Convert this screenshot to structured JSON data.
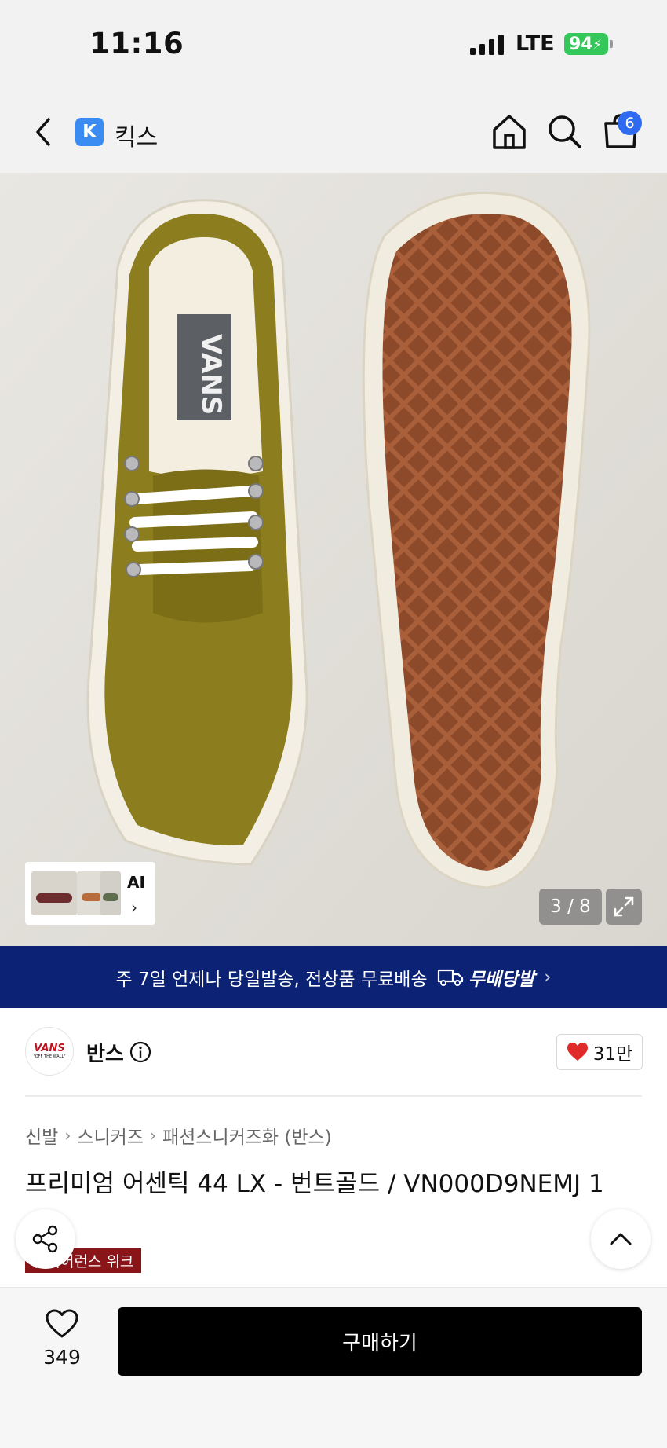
{
  "status": {
    "time": "11:16",
    "network": "LTE",
    "battery": "94"
  },
  "nav": {
    "logo_letter": "K",
    "title": "킥스",
    "cart_count": "6"
  },
  "gallery": {
    "ai_label": "AI",
    "counter": "3 / 8",
    "ai_chevron": "›"
  },
  "banner": {
    "text": "주 7일 언제나 당일발송, 전상품 무료배송",
    "service": "무배당발",
    "chevron": "›"
  },
  "brand": {
    "logo_text": "VANS",
    "logo_sub": "\"OFF THE WALL\"",
    "name": "반스",
    "likes": "31만"
  },
  "breadcrumb": [
    "신발",
    "스니커즈",
    "패션스니커즈화 (반스)"
  ],
  "breadcrumb_sep": "›",
  "product": {
    "title": "프리미엄 어센틱 44 LX - 번트골드 / VN000D9NEMJ 1",
    "tag": "클리어런스 위크"
  },
  "bottom": {
    "wish_count": "349",
    "buy_label": "구매하기"
  },
  "colors": {
    "nav_bg": "#f2f2f3",
    "banner_bg": "#0b2275",
    "badge": "#2f6bf0",
    "heart": "#e02b2b",
    "buy_bg": "#000000",
    "tag_bg": "#8a1518"
  }
}
